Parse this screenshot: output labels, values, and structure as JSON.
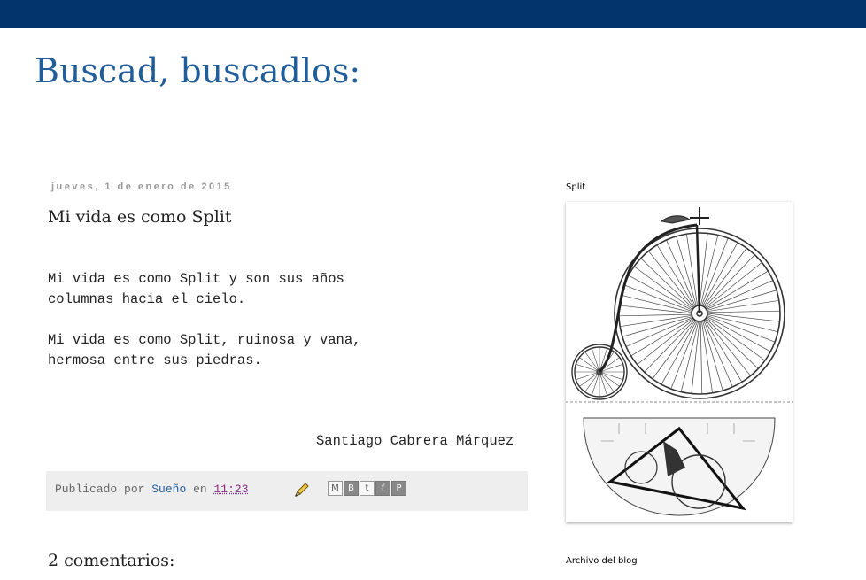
{
  "blog": {
    "title": "Buscad, buscadlos:"
  },
  "post": {
    "date": "jueves, 1 de enero de 2015",
    "title": "Mi vida es como Split",
    "stanzas": [
      {
        "line1": "Mi vida es como Split y son sus años",
        "line2": "columnas hacia el cielo."
      },
      {
        "line1": "Mi vida es como Split, ruinosa y vana,",
        "line2": "hermosa entre sus piedras."
      }
    ],
    "signature": "Santiago Cabrera Márquez",
    "footer": {
      "published_by": "Publicado por",
      "author": "Sueño",
      "in": "en",
      "time": "11:23"
    }
  },
  "share": [
    "M",
    "B",
    "t",
    "f",
    "P"
  ],
  "comments": {
    "title": "2 comentarios:"
  },
  "sidebar": {
    "image_widget_title": "Split",
    "archive_title": "Archivo del blog"
  },
  "colors": {
    "topbar": "#03346b",
    "title": "#1f5d9b",
    "link": "#1f5d9b",
    "time": "#8a2a8a"
  },
  "icons": [
    "pencil-icon",
    "email-icon",
    "blogger-icon",
    "twitter-icon",
    "facebook-icon",
    "pinterest-icon"
  ]
}
